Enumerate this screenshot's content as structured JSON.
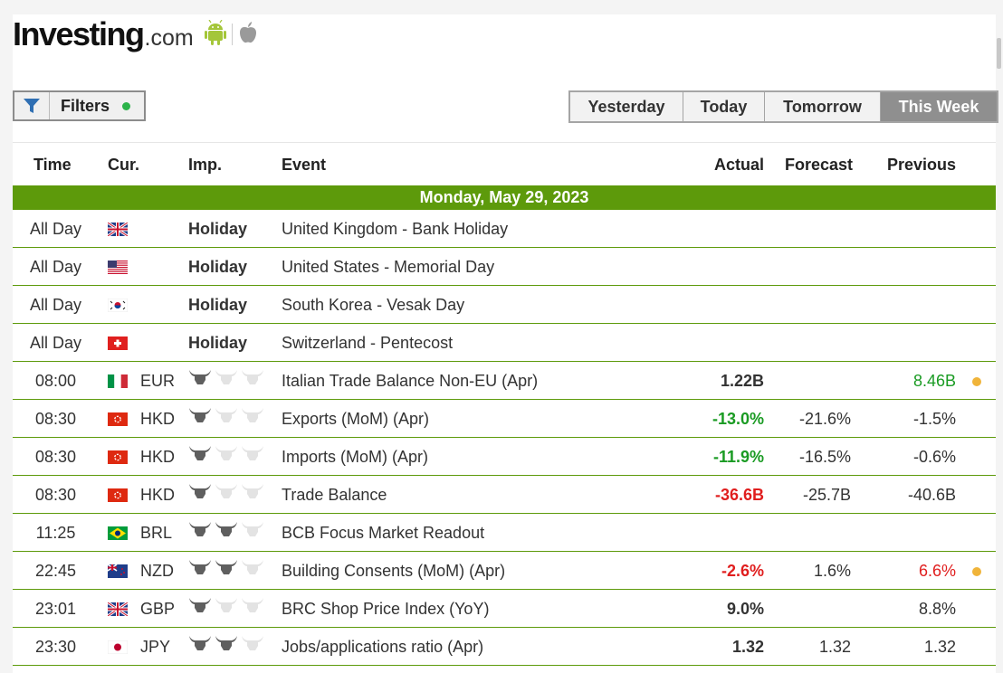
{
  "brand": {
    "name": "Investing",
    "suffix": ".com"
  },
  "icons": {
    "android": "android-icon",
    "apple": "apple-icon",
    "filter": "funnel-icon",
    "bull": "bull-icon"
  },
  "colors": {
    "green_header": "#5d9a0b",
    "positive": "#1a9b23",
    "negative": "#e01e1e",
    "alert_dot": "#f0b43a",
    "filter_dot": "#2cb34a"
  },
  "filters": {
    "label": "Filters"
  },
  "tabs": [
    "Yesterday",
    "Today",
    "Tomorrow",
    "This Week"
  ],
  "active_tab": "This Week",
  "columns": {
    "time": "Time",
    "cur": "Cur.",
    "imp": "Imp.",
    "event": "Event",
    "actual": "Actual",
    "forecast": "Forecast",
    "previous": "Previous"
  },
  "day_header": "Monday, May 29, 2023",
  "rows": [
    {
      "time": "All Day",
      "flag": "gb",
      "cur": "",
      "importance": "Holiday",
      "event": "United Kingdom - Bank Holiday",
      "actual": "",
      "forecast": "",
      "previous": ""
    },
    {
      "time": "All Day",
      "flag": "us",
      "cur": "",
      "importance": "Holiday",
      "event": "United States - Memorial Day",
      "actual": "",
      "forecast": "",
      "previous": ""
    },
    {
      "time": "All Day",
      "flag": "kr",
      "cur": "",
      "importance": "Holiday",
      "event": "South Korea - Vesak Day",
      "actual": "",
      "forecast": "",
      "previous": ""
    },
    {
      "time": "All Day",
      "flag": "ch",
      "cur": "",
      "importance": "Holiday",
      "event": "Switzerland - Pentecost",
      "actual": "",
      "forecast": "",
      "previous": ""
    },
    {
      "time": "08:00",
      "flag": "it",
      "cur": "EUR",
      "importance": 1,
      "event": "Italian Trade Balance Non-EU (Apr)",
      "actual": "1.22B",
      "actual_color": "neutral",
      "forecast": "",
      "previous": "8.46B",
      "previous_color": "pos",
      "alert_dot": true
    },
    {
      "time": "08:30",
      "flag": "hk",
      "cur": "HKD",
      "importance": 1,
      "event": "Exports (MoM) (Apr)",
      "actual": "-13.0%",
      "actual_color": "pos",
      "forecast": "-21.6%",
      "previous": "-1.5%",
      "previous_color": "neutral",
      "alert_dot": false
    },
    {
      "time": "08:30",
      "flag": "hk",
      "cur": "HKD",
      "importance": 1,
      "event": "Imports (MoM) (Apr)",
      "actual": "-11.9%",
      "actual_color": "pos",
      "forecast": "-16.5%",
      "previous": "-0.6%",
      "previous_color": "neutral",
      "alert_dot": false
    },
    {
      "time": "08:30",
      "flag": "hk",
      "cur": "HKD",
      "importance": 1,
      "event": "Trade Balance",
      "actual": "-36.6B",
      "actual_color": "neg",
      "forecast": "-25.7B",
      "previous": "-40.6B",
      "previous_color": "neutral",
      "alert_dot": false
    },
    {
      "time": "11:25",
      "flag": "br",
      "cur": "BRL",
      "importance": 2,
      "event": "BCB Focus Market Readout",
      "actual": "",
      "actual_color": "neutral",
      "forecast": "",
      "previous": "",
      "previous_color": "neutral",
      "alert_dot": false
    },
    {
      "time": "22:45",
      "flag": "nz",
      "cur": "NZD",
      "importance": 2,
      "event": "Building Consents (MoM) (Apr)",
      "actual": "-2.6%",
      "actual_color": "neg",
      "forecast": "1.6%",
      "previous": "6.6%",
      "previous_color": "neg",
      "alert_dot": true
    },
    {
      "time": "23:01",
      "flag": "gb",
      "cur": "GBP",
      "importance": 1,
      "event": "BRC Shop Price Index (YoY)",
      "actual": "9.0%",
      "actual_color": "neutral",
      "forecast": "",
      "previous": "8.8%",
      "previous_color": "neutral",
      "alert_dot": false
    },
    {
      "time": "23:30",
      "flag": "jp",
      "cur": "JPY",
      "importance": 2,
      "event": "Jobs/applications ratio (Apr)",
      "actual": "1.32",
      "actual_color": "neutral",
      "forecast": "1.32",
      "previous": "1.32",
      "previous_color": "neutral",
      "alert_dot": false
    }
  ]
}
